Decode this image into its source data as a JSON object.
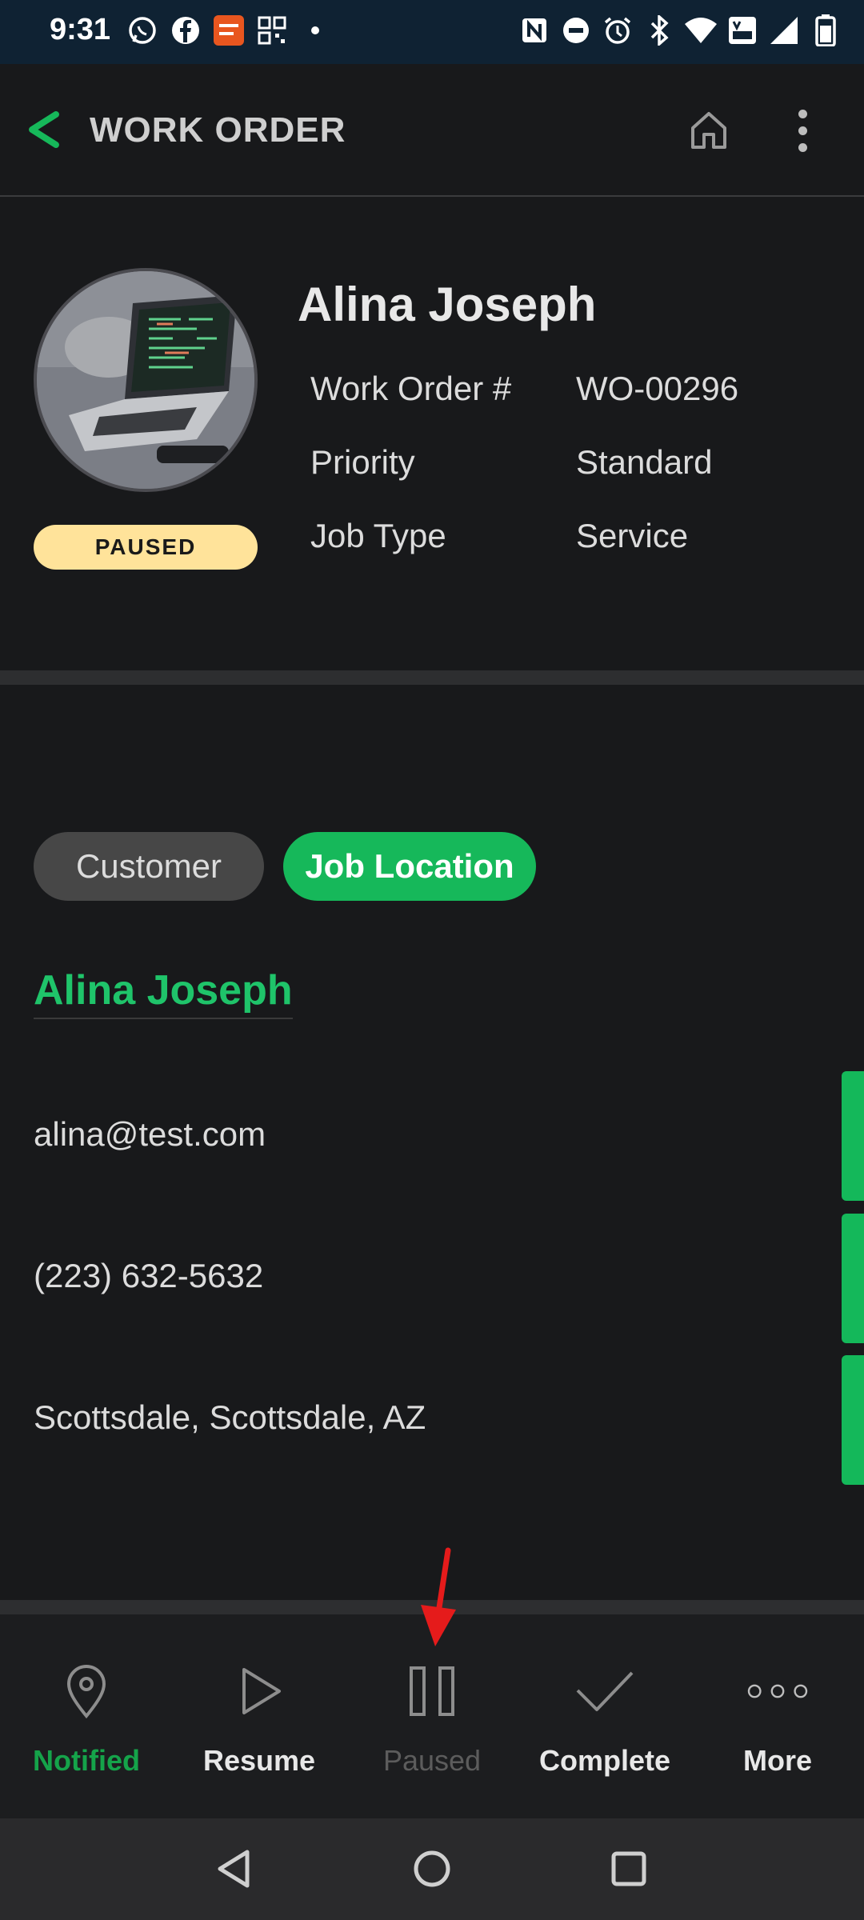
{
  "status_bar": {
    "time": "9:31",
    "left_icons": [
      "whatsapp-icon",
      "facebook-icon",
      "app-badge-icon",
      "qr-icon",
      "dot-icon"
    ],
    "right_icons": [
      "nfc-icon",
      "dnd-icon",
      "alarm-icon",
      "bluetooth-icon",
      "wifi-icon",
      "volte-icon",
      "signal-icon",
      "battery-icon"
    ]
  },
  "app_bar": {
    "title": "WORK ORDER",
    "back_icon": "chevron-left-icon",
    "home_icon": "home-icon",
    "menu_icon": "kebab-menu-icon"
  },
  "header": {
    "name": "Alina Joseph",
    "status": "PAUSED",
    "fields": [
      {
        "label": "Work Order #",
        "value": "WO-00296"
      },
      {
        "label": "Priority",
        "value": "Standard"
      },
      {
        "label": "Job Type",
        "value": "Service"
      }
    ]
  },
  "contact": {
    "tabs": [
      {
        "label": "Customer",
        "active": false
      },
      {
        "label": "Job Location",
        "active": true
      }
    ],
    "name": "Alina Joseph",
    "email": "alina@test.com",
    "phone": "(223) 632-5632",
    "address": "Scottsdale, Scottsdale, AZ"
  },
  "actions": [
    {
      "label": "Notified",
      "icon": "location-pin-icon",
      "state": "done"
    },
    {
      "label": "Resume",
      "icon": "play-icon",
      "state": "enabled"
    },
    {
      "label": "Paused",
      "icon": "pause-icon",
      "state": "disabled"
    },
    {
      "label": "Complete",
      "icon": "checkmark-icon",
      "state": "enabled"
    },
    {
      "label": "More",
      "icon": "more-dots-icon",
      "state": "enabled"
    }
  ],
  "colors": {
    "accent_green": "#16b85a",
    "status_paused": "#ffe39a",
    "background": "#18191b"
  }
}
